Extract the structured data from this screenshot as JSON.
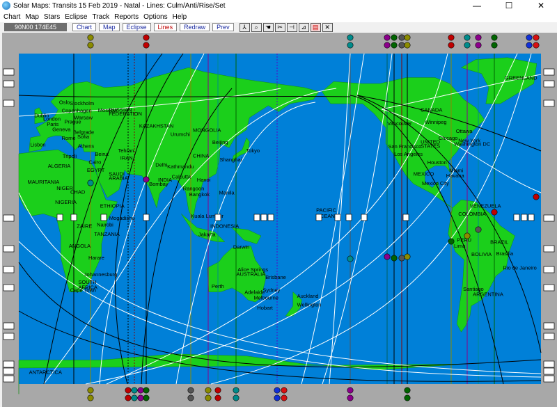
{
  "window": {
    "title": "Solar Maps: Transits 15 Feb 2019 - Natal - Lines: Culm/Anti/Rise/Set",
    "minimize_glyph": "—",
    "maximize_glyph": "☐",
    "close_glyph": "✕"
  },
  "menu": [
    "Chart",
    "Map",
    "Stars",
    "Eclipse",
    "Track",
    "Reports",
    "Options",
    "Help"
  ],
  "toolbar": {
    "coordinate": "90N00  174E45",
    "buttons": [
      {
        "label": "Chart",
        "highlight": false
      },
      {
        "label": "Map",
        "highlight": false
      },
      {
        "label": "Eclipse",
        "highlight": false
      },
      {
        "label": "Lines",
        "highlight": true
      },
      {
        "label": "Redraw",
        "highlight": false
      },
      {
        "label": "Prev",
        "highlight": false
      }
    ],
    "icons": [
      "compass-icon",
      "zoom-icon",
      "hand-icon",
      "scissors-icon",
      "plug-icon",
      "chart-icon",
      "report-icon",
      "crosshair-icon"
    ]
  },
  "colors": {
    "ocean": "#0080d8",
    "land": "#1bcf1b",
    "red_symbol": "#d81010",
    "blue_symbol": "#1030d8"
  },
  "map": {
    "city_labels": [
      {
        "name": "GREENLAND",
        "lon": -42,
        "lat": 72
      },
      {
        "name": "Oslo",
        "lon": 10.8,
        "lat": 59.9
      },
      {
        "name": "Dublin",
        "lon": -6.3,
        "lat": 53.3
      },
      {
        "name": "London",
        "lon": -0.2,
        "lat": 51.5
      },
      {
        "name": "Stockholm",
        "lon": 18.1,
        "lat": 59.3
      },
      {
        "name": "Copenhagen",
        "lon": 12.6,
        "lat": 55.7
      },
      {
        "name": "Warsaw",
        "lon": 21,
        "lat": 52.2
      },
      {
        "name": "Prague",
        "lon": 14.4,
        "lat": 50.1
      },
      {
        "name": "Paris",
        "lon": 2.3,
        "lat": 48.9
      },
      {
        "name": "Geneva",
        "lon": 6.1,
        "lat": 46.2
      },
      {
        "name": "Belgrade",
        "lon": 20.5,
        "lat": 44.8
      },
      {
        "name": "Sofia",
        "lon": 23.3,
        "lat": 42.7
      },
      {
        "name": "Rome",
        "lon": 12.5,
        "lat": 41.9
      },
      {
        "name": "Lisbon",
        "lon": -9.1,
        "lat": 38.7
      },
      {
        "name": "Athens",
        "lon": 23.7,
        "lat": 38
      },
      {
        "name": "Tripoli",
        "lon": 13.2,
        "lat": 32.9
      },
      {
        "name": "Beirut",
        "lon": 35.5,
        "lat": 33.9
      },
      {
        "name": "Cairo",
        "lon": 31.2,
        "lat": 30
      },
      {
        "name": "ALGERIA",
        "lon": 3,
        "lat": 28
      },
      {
        "name": "EGYPT",
        "lon": 30,
        "lat": 26
      },
      {
        "name": "MAURITANIA",
        "lon": -11,
        "lat": 20
      },
      {
        "name": "NIGER",
        "lon": 9,
        "lat": 17
      },
      {
        "name": "CHAD",
        "lon": 18.5,
        "lat": 15
      },
      {
        "name": "NIGERIA",
        "lon": 8,
        "lat": 10
      },
      {
        "name": "ETHIOPIA",
        "lon": 39,
        "lat": 8
      },
      {
        "name": "ZAIRE",
        "lon": 23,
        "lat": -2
      },
      {
        "name": "Nairobi",
        "lon": 36.8,
        "lat": -1.3
      },
      {
        "name": "TANZANIA",
        "lon": 35,
        "lat": -6
      },
      {
        "name": "ANGOLA",
        "lon": 17.5,
        "lat": -12
      },
      {
        "name": "Harare",
        "lon": 31,
        "lat": -17.8
      },
      {
        "name": "Johannesburg",
        "lon": 28,
        "lat": -26.2
      },
      {
        "name": "SOUTH",
        "lon": 24,
        "lat": -30
      },
      {
        "name": "AFRICA",
        "lon": 24,
        "lat": -32.5
      },
      {
        "name": "Cape Town",
        "lon": 18.4,
        "lat": -33.9
      },
      {
        "name": "RUSSIAN",
        "lon": 45,
        "lat": 56
      },
      {
        "name": "FEDERATION",
        "lon": 45,
        "lat": 54
      },
      {
        "name": "Moscow",
        "lon": 37.6,
        "lat": 55.8
      },
      {
        "name": "KAZAKHSTAN",
        "lon": 66,
        "lat": 48
      },
      {
        "name": "MONGOLIA",
        "lon": 103,
        "lat": 46
      },
      {
        "name": "Urumchi",
        "lon": 87.6,
        "lat": 43.8
      },
      {
        "name": "Tehran",
        "lon": 51.4,
        "lat": 35.7
      },
      {
        "name": "IRAN",
        "lon": 53,
        "lat": 32
      },
      {
        "name": "SAUDI",
        "lon": 45,
        "lat": 24
      },
      {
        "name": "ARABIA",
        "lon": 45,
        "lat": 22
      },
      {
        "name": "Delhi",
        "lon": 77.2,
        "lat": 28.6
      },
      {
        "name": "Kathmandu",
        "lon": 85.3,
        "lat": 27.7
      },
      {
        "name": "INDIA",
        "lon": 79,
        "lat": 21
      },
      {
        "name": "Bombay",
        "lon": 72.8,
        "lat": 19
      },
      {
        "name": "Calcutta",
        "lon": 88.4,
        "lat": 22.6
      },
      {
        "name": "CHINA",
        "lon": 103,
        "lat": 33
      },
      {
        "name": "Beijing",
        "lon": 116.4,
        "lat": 39.9
      },
      {
        "name": "Shanghai",
        "lon": 121.5,
        "lat": 31.2
      },
      {
        "name": "Tokyo",
        "lon": 139.7,
        "lat": 35.7
      },
      {
        "name": "Hanoi",
        "lon": 105.8,
        "lat": 21
      },
      {
        "name": "Rangoon",
        "lon": 96.2,
        "lat": 16.8
      },
      {
        "name": "Bangkok",
        "lon": 100.5,
        "lat": 13.8
      },
      {
        "name": "Manila",
        "lon": 121,
        "lat": 14.6
      },
      {
        "name": "Mogadishu",
        "lon": 45.3,
        "lat": 2
      },
      {
        "name": "Kuala Lumpur",
        "lon": 101.7,
        "lat": 3.1
      },
      {
        "name": "INDONESIA",
        "lon": 115,
        "lat": -2
      },
      {
        "name": "Jakarta",
        "lon": 106.8,
        "lat": -6.2
      },
      {
        "name": "Darwin",
        "lon": 130.8,
        "lat": -12.5
      },
      {
        "name": "Alice Springs",
        "lon": 133.9,
        "lat": -23.7
      },
      {
        "name": "AUSTRALIA",
        "lon": 133,
        "lat": -26
      },
      {
        "name": "Brisbane",
        "lon": 153,
        "lat": -27.5
      },
      {
        "name": "Perth",
        "lon": 115.9,
        "lat": -32
      },
      {
        "name": "Adelaide",
        "lon": 138.6,
        "lat": -35
      },
      {
        "name": "Sydney",
        "lon": 151.2,
        "lat": -33.9
      },
      {
        "name": "Melbourne",
        "lon": 145,
        "lat": -37.8
      },
      {
        "name": "Hobart",
        "lon": 147.3,
        "lat": -42.9
      },
      {
        "name": "Auckland",
        "lon": 174.8,
        "lat": -36.9
      },
      {
        "name": "Wellington",
        "lon": 174.8,
        "lat": -41.3
      },
      {
        "name": "PACIFIC",
        "lon": -172,
        "lat": 6
      },
      {
        "name": "OCEAN",
        "lon": -172,
        "lat": 3
      },
      {
        "name": "Vancouver",
        "lon": -123,
        "lat": 49.3
      },
      {
        "name": "CANADA",
        "lon": -100,
        "lat": 56
      },
      {
        "name": "Winnipeg",
        "lon": -97,
        "lat": 50
      },
      {
        "name": "Ottawa",
        "lon": -75.7,
        "lat": 45.4
      },
      {
        "name": "Chicago",
        "lon": -87.6,
        "lat": 41.9
      },
      {
        "name": "UNITED",
        "lon": -100,
        "lat": 40
      },
      {
        "name": "STATES",
        "lon": -100,
        "lat": 38
      },
      {
        "name": "New York",
        "lon": -74,
        "lat": 40.7
      },
      {
        "name": "Washington DC",
        "lon": -77,
        "lat": 38.9
      },
      {
        "name": "San Francisco",
        "lon": -122.4,
        "lat": 37.8
      },
      {
        "name": "Los Angeles",
        "lon": -118.2,
        "lat": 34
      },
      {
        "name": "Houston",
        "lon": -95.4,
        "lat": 29.8
      },
      {
        "name": "MEXICO",
        "lon": -105,
        "lat": 24
      },
      {
        "name": "Miami",
        "lon": -80.2,
        "lat": 25.8
      },
      {
        "name": "Havana",
        "lon": -82.4,
        "lat": 23.1
      },
      {
        "name": "Mexico City",
        "lon": -99.1,
        "lat": 19.4
      },
      {
        "name": "VENEZUELA",
        "lon": -66,
        "lat": 8
      },
      {
        "name": "COLOMBIA",
        "lon": -74,
        "lat": 4
      },
      {
        "name": "PERU",
        "lon": -75,
        "lat": -9
      },
      {
        "name": "Lima",
        "lon": -77,
        "lat": -12
      },
      {
        "name": "BRAZIL",
        "lon": -52,
        "lat": -10
      },
      {
        "name": "BOLIVIA",
        "lon": -65,
        "lat": -16
      },
      {
        "name": "Brasilia",
        "lon": -47.9,
        "lat": -15.8
      },
      {
        "name": "Rio de Janeiro",
        "lon": -43.2,
        "lat": -22.9
      },
      {
        "name": "Santiago",
        "lon": -70.7,
        "lat": -33.4
      },
      {
        "name": "ARGENTINA",
        "lon": -64,
        "lat": -36
      },
      {
        "name": "ANTARCTICA",
        "lon": -10,
        "lat": -75
      }
    ]
  }
}
